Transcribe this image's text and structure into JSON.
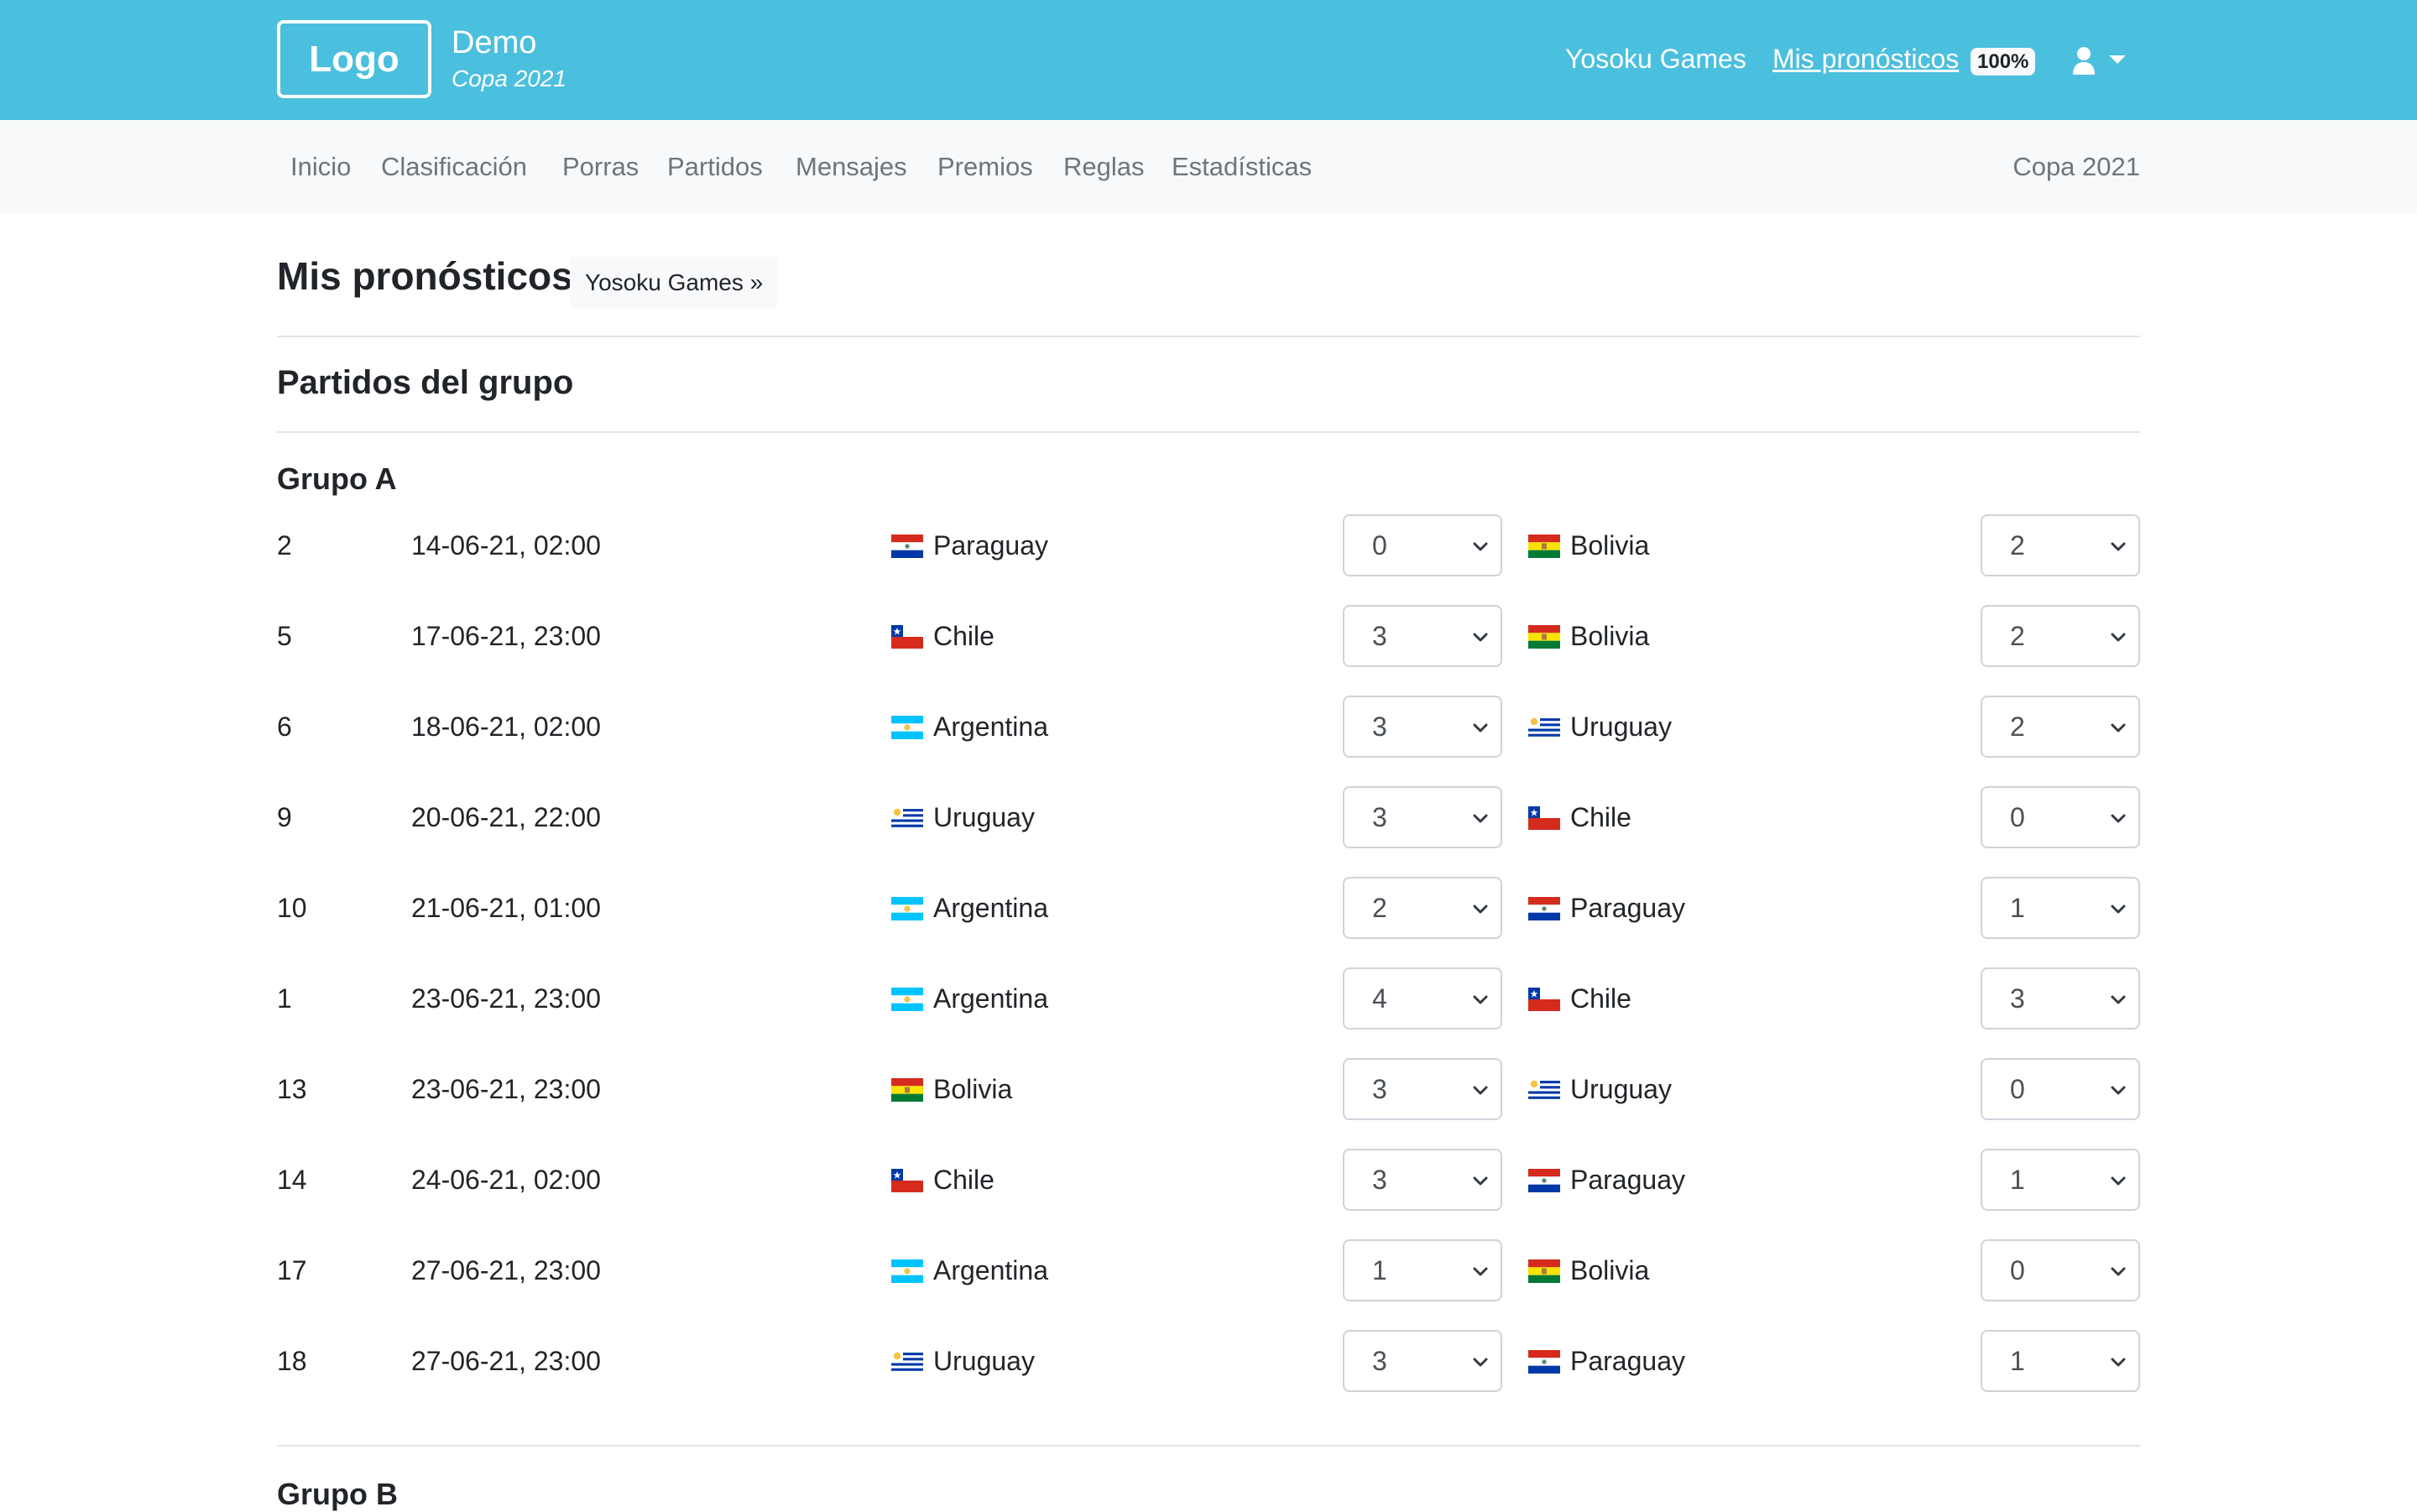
{
  "header": {
    "logo_text": "Logo",
    "brand_title": "Demo",
    "brand_subtitle": "Copa 2021",
    "links": {
      "yosoku": "Yosoku Games",
      "mis_pronosticos": "Mis pronósticos",
      "completion_badge": "100%"
    },
    "user_menu_icon": "user-icon",
    "colors": {
      "header_bg": "#4bbfde",
      "nav_bg": "#f8f9fa"
    }
  },
  "nav": {
    "items": [
      "Inicio",
      "Clasificación",
      "Porras",
      "Partidos",
      "Mensajes",
      "Premios",
      "Reglas",
      "Estadísticas"
    ],
    "right_label": "Copa 2021"
  },
  "page": {
    "title": "Mis pronósticos",
    "crumb_button": "Yosoku Games »",
    "section_title": "Partidos del grupo"
  },
  "groups": [
    {
      "name": "Grupo A",
      "matches": [
        {
          "num": "2",
          "date": "14-06-21, 02:00",
          "home": "Paraguay",
          "home_flag": "paraguay",
          "home_score": "0",
          "away": "Bolivia",
          "away_flag": "bolivia",
          "away_score": "2"
        },
        {
          "num": "5",
          "date": "17-06-21, 23:00",
          "home": "Chile",
          "home_flag": "chile",
          "home_score": "3",
          "away": "Bolivia",
          "away_flag": "bolivia",
          "away_score": "2"
        },
        {
          "num": "6",
          "date": "18-06-21, 02:00",
          "home": "Argentina",
          "home_flag": "argentina",
          "home_score": "3",
          "away": "Uruguay",
          "away_flag": "uruguay",
          "away_score": "2"
        },
        {
          "num": "9",
          "date": "20-06-21, 22:00",
          "home": "Uruguay",
          "home_flag": "uruguay",
          "home_score": "3",
          "away": "Chile",
          "away_flag": "chile",
          "away_score": "0"
        },
        {
          "num": "10",
          "date": "21-06-21, 01:00",
          "home": "Argentina",
          "home_flag": "argentina",
          "home_score": "2",
          "away": "Paraguay",
          "away_flag": "paraguay",
          "away_score": "1"
        },
        {
          "num": "1",
          "date": "23-06-21, 23:00",
          "home": "Argentina",
          "home_flag": "argentina",
          "home_score": "4",
          "away": "Chile",
          "away_flag": "chile",
          "away_score": "3"
        },
        {
          "num": "13",
          "date": "23-06-21, 23:00",
          "home": "Bolivia",
          "home_flag": "bolivia",
          "home_score": "3",
          "away": "Uruguay",
          "away_flag": "uruguay",
          "away_score": "0"
        },
        {
          "num": "14",
          "date": "24-06-21, 02:00",
          "home": "Chile",
          "home_flag": "chile",
          "home_score": "3",
          "away": "Paraguay",
          "away_flag": "paraguay",
          "away_score": "1"
        },
        {
          "num": "17",
          "date": "27-06-21, 23:00",
          "home": "Argentina",
          "home_flag": "argentina",
          "home_score": "1",
          "away": "Bolivia",
          "away_flag": "bolivia",
          "away_score": "0"
        },
        {
          "num": "18",
          "date": "27-06-21, 23:00",
          "home": "Uruguay",
          "home_flag": "uruguay",
          "home_score": "3",
          "away": "Paraguay",
          "away_flag": "paraguay",
          "away_score": "1"
        }
      ]
    },
    {
      "name": "Grupo B",
      "matches": []
    }
  ]
}
